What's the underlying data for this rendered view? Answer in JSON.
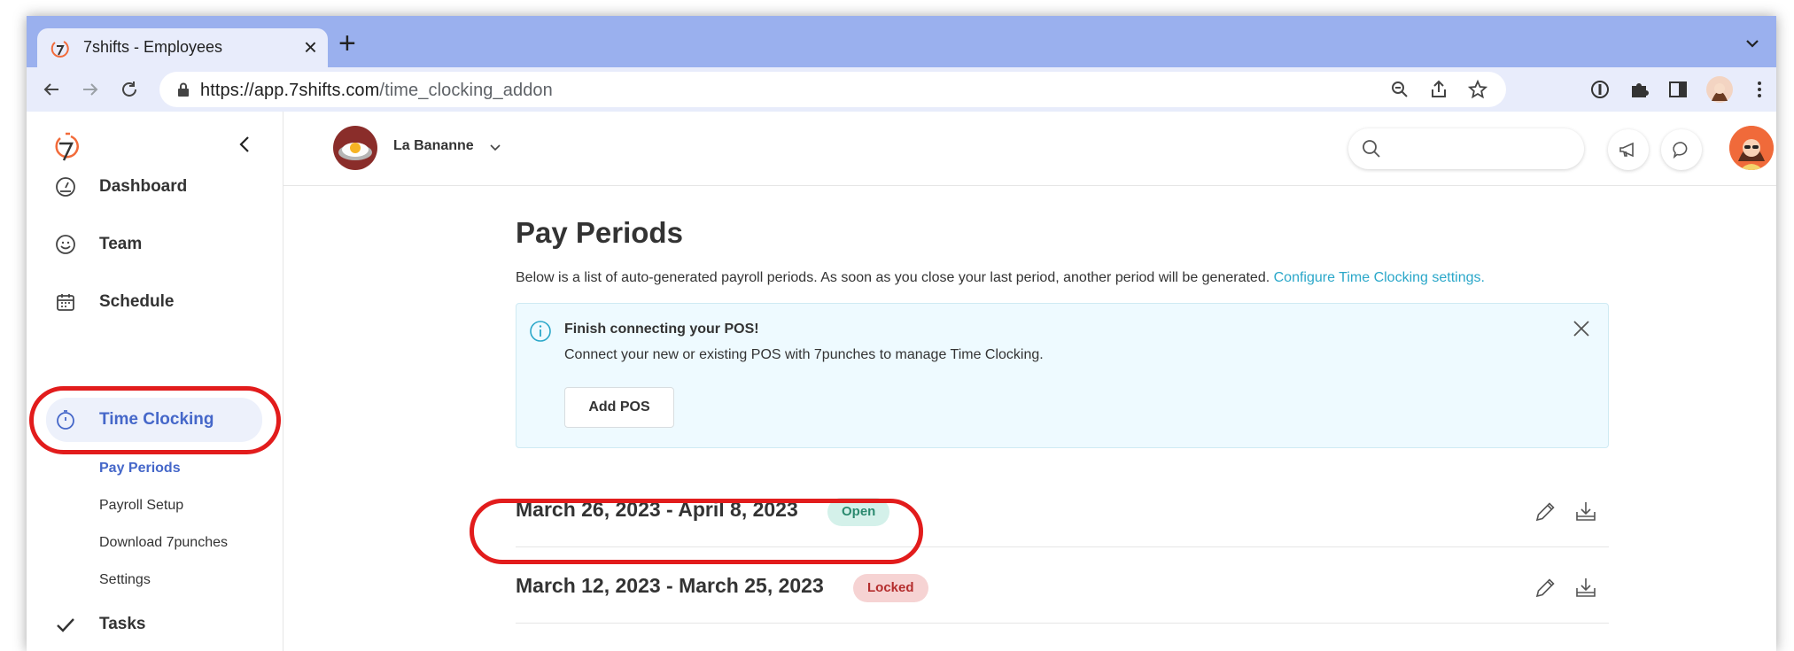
{
  "browser": {
    "tab_title": "7shifts - Employees",
    "tab_close": "×",
    "new_tab": "+",
    "url_host": "https://app.7shifts.com",
    "url_path": "/time_clocking_addon"
  },
  "sidebar": {
    "items": [
      {
        "label": "Dashboard",
        "icon": "gauge-icon"
      },
      {
        "label": "Team",
        "icon": "smiley-icon"
      },
      {
        "label": "Schedule",
        "icon": "calendar-icon"
      },
      {
        "label": "Time Clocking",
        "icon": "stopwatch-icon",
        "active": true
      },
      {
        "label": "Tasks",
        "icon": "checkmark-icon"
      }
    ],
    "sub_items": [
      {
        "label": "Pay Periods",
        "active": true
      },
      {
        "label": "Payroll Setup"
      },
      {
        "label": "Download 7punches"
      },
      {
        "label": "Settings"
      }
    ]
  },
  "topbar": {
    "location_name": "La Bananne"
  },
  "main": {
    "title": "Pay Periods",
    "description": "Below is a list of auto-generated payroll periods. As soon as you close your last period, another period will be generated.",
    "settings_link": "Configure Time Clocking settings.",
    "alert": {
      "title": "Finish connecting your POS!",
      "text": "Connect your new or existing POS with 7punches to manage Time Clocking.",
      "button": "Add POS"
    },
    "periods": [
      {
        "dates": "March 26, 2023 - April 8, 2023",
        "status": "Open"
      },
      {
        "dates": "March 12, 2023 - March 25, 2023",
        "status": "Locked"
      }
    ]
  },
  "colors": {
    "accent": "#4567c9",
    "link": "#2aa7c9",
    "highlight": "#e21c1c",
    "open_badge_bg": "#d4f1ea",
    "locked_badge_bg": "#f6d3d3"
  }
}
